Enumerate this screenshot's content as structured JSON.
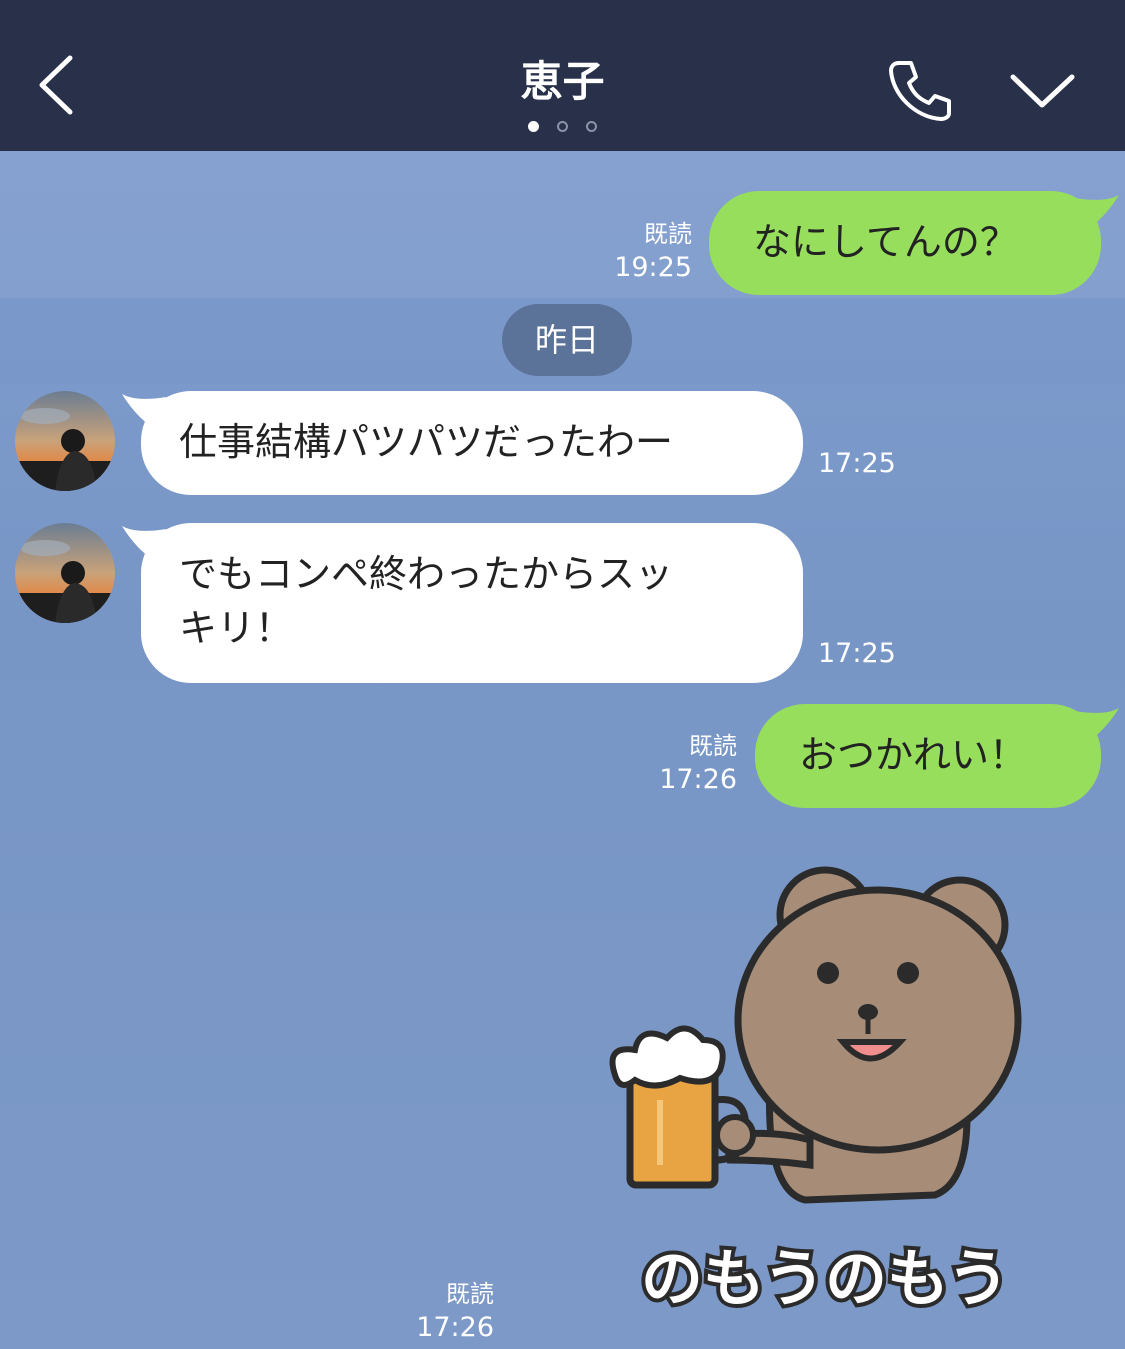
{
  "header": {
    "title": "恵子",
    "pages": 3,
    "active_page": 0
  },
  "messages": [
    {
      "from": "me",
      "text": "なにしてんの？",
      "read": "既読",
      "time": "19:25"
    },
    {
      "type": "date",
      "text": "昨日"
    },
    {
      "from": "contact",
      "text": "仕事結構パツパツだったわー",
      "time": "17:25"
    },
    {
      "from": "contact",
      "text_line1": "でもコンペ終わったからスッ",
      "text_line2": "キリ！",
      "time": "17:25"
    },
    {
      "from": "me",
      "text": "おつかれい！",
      "read": "既読",
      "time": "17:26"
    },
    {
      "from": "me",
      "type": "sticker",
      "sticker_text": "のもうのもう",
      "read": "既読",
      "time": "17:26"
    }
  ],
  "colors": {
    "header_bg": "#283149",
    "chat_bg": "#7895c4",
    "my_bubble": "#97de5c",
    "their_bubble": "#ffffff",
    "date_pill": "#5c7399"
  },
  "icons": [
    "back-chevron-icon",
    "phone-icon",
    "chevron-down-icon"
  ]
}
